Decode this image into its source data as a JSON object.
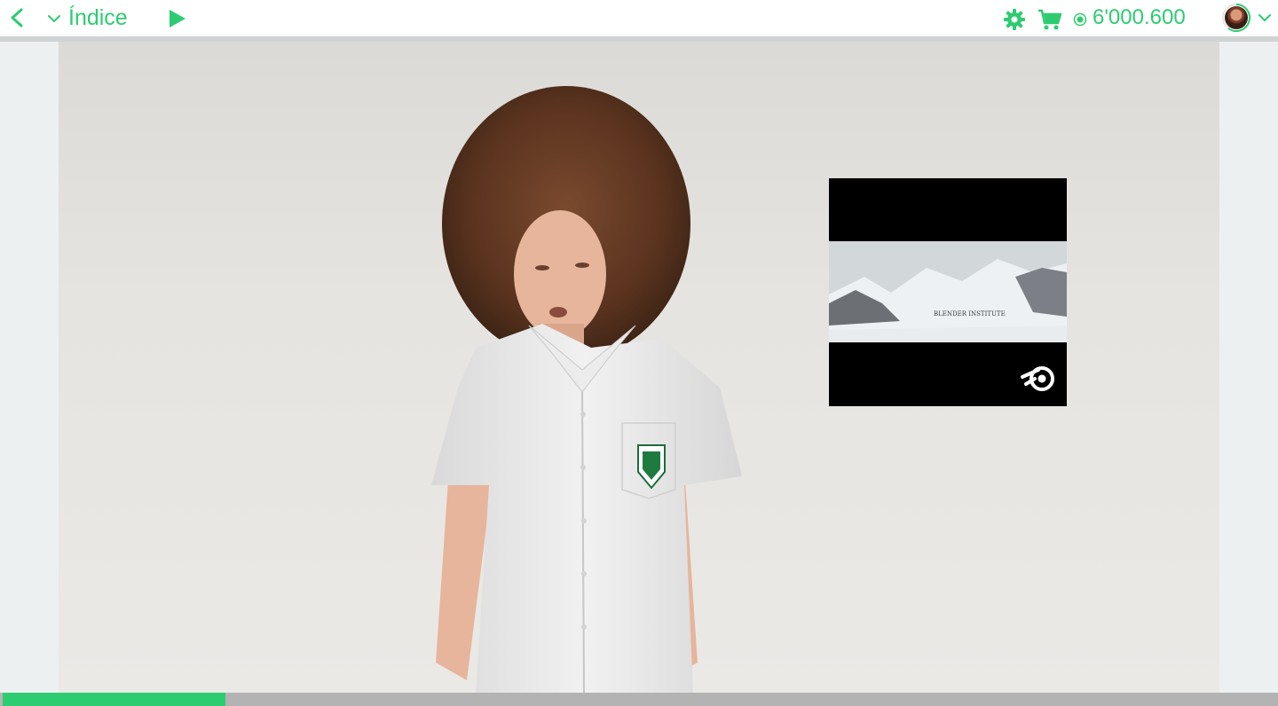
{
  "header": {
    "index_label": "Índice",
    "coin_value": "6'000.600"
  },
  "icons": {
    "back": "chevron-left-icon",
    "index_toggle": "chevron-down-icon",
    "play": "play-icon",
    "settings": "gear-icon",
    "cart": "cart-icon",
    "coins": "coin-icon",
    "user_menu": "chevron-down-icon"
  },
  "video": {
    "progress": 0.175,
    "overlay_caption": "BLENDER INSTITUTE"
  },
  "colors": {
    "accent": "#2ecc71",
    "progress_track": "#b3b3b3",
    "page_bg": "#ecf0f1"
  }
}
